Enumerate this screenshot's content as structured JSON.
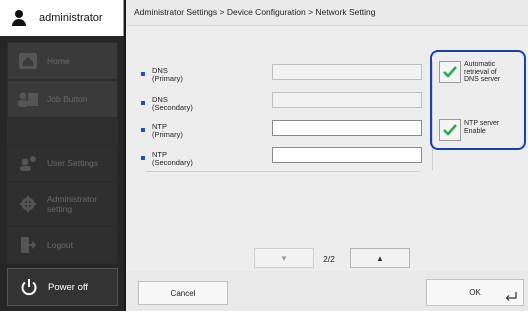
{
  "user": {
    "name": "administrator",
    "icon": "user-icon"
  },
  "sidebar": {
    "items": [
      {
        "label": "Home",
        "icon": "home-icon"
      },
      {
        "label": "Job Button",
        "icon": "job-button-icon"
      },
      {
        "label": "User Settings",
        "icon": "user-settings-icon"
      },
      {
        "label": "Administrator setting",
        "icon": "admin-gear-icon"
      },
      {
        "label": "Logout",
        "icon": "logout-icon"
      }
    ],
    "power_label": "Power off"
  },
  "breadcrumb": "Administrator Settings > Device Configuration > Network Setting",
  "fields": [
    {
      "label_line1": "DNS",
      "label_line2": "(Primary)",
      "value": "",
      "state": "disabled"
    },
    {
      "label_line1": "DNS",
      "label_line2": "(Secondary)",
      "value": "",
      "state": "disabled"
    },
    {
      "label_line1": "NTP",
      "label_line2": "(Primary)",
      "value": "",
      "state": "enabled"
    },
    {
      "label_line1": "NTP",
      "label_line2": "(Secondary)",
      "value": "",
      "state": "enabled"
    }
  ],
  "options": [
    {
      "label_line1": "Automatic",
      "label_line2": "retrieval of",
      "label_line3": "DNS server",
      "checked": true
    },
    {
      "label_line1": "NTP server",
      "label_line2": "Enable",
      "checked": true
    }
  ],
  "pager": {
    "page": "2/2"
  },
  "buttons": {
    "cancel": "Cancel",
    "ok": "OK"
  },
  "colors": {
    "accent": "#1a3fb3",
    "bullet": "#2050c0",
    "check": "#2aa84a"
  }
}
